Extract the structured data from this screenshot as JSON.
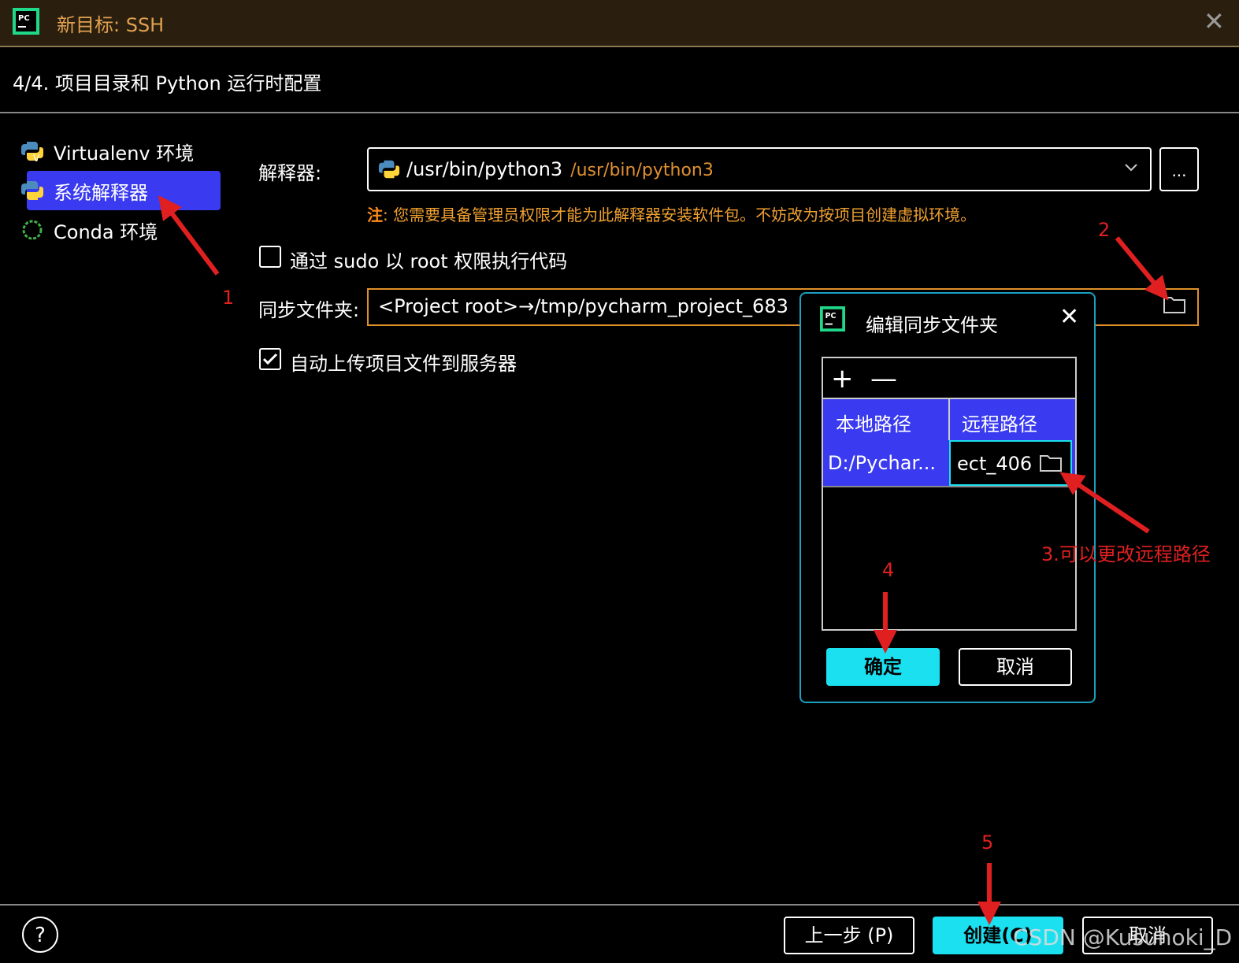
{
  "window": {
    "title": "新目标: SSH",
    "close": "✕"
  },
  "step_header": "4/4. 项目目录和 Python 运行时配置",
  "sidebar": {
    "items": [
      {
        "label": "Virtualenv 环境"
      },
      {
        "label": "系统解释器",
        "selected": true
      },
      {
        "label": "Conda 环境"
      }
    ]
  },
  "form": {
    "interpreter_label": "解释器:",
    "interpreter_value": "/usr/bin/python3",
    "interpreter_path": "/usr/bin/python3",
    "browse": "...",
    "note_prefix": "注",
    "note_text": ": 您需要具备管理员权限才能为此解释器安装软件包。不妨改为按项目创建虚拟环境。",
    "sudo_label": "通过 sudo 以 root 权限执行代码",
    "sudo_checked": false,
    "sync_label": "同步文件夹:",
    "sync_value": "<Project root>→/tmp/pycharm_project_683",
    "upload_label": "自动上传项目文件到服务器",
    "upload_checked": true
  },
  "dialog": {
    "title": "编辑同步文件夹",
    "close": "✕",
    "add": "+",
    "remove": "—",
    "col_local": "本地路径",
    "col_remote": "远程路径",
    "row_local": "D:/Pychar...",
    "row_remote": "ect_406",
    "ok": "确定",
    "cancel": "取消"
  },
  "footer": {
    "help": "?",
    "back": "上一步 (P)",
    "create": "创建(C)",
    "cancel": "取消"
  },
  "watermark": "CSDN @Kusunoki_D",
  "annotations": {
    "n1": "1",
    "n2": "2",
    "n3": "3.可以更改远程路径",
    "n4": "4",
    "n5": "5"
  },
  "colors": {
    "accent": "#1ae0f0",
    "selection": "#3a3af0",
    "warning": "#f0a030",
    "annotation": "#e02020"
  }
}
